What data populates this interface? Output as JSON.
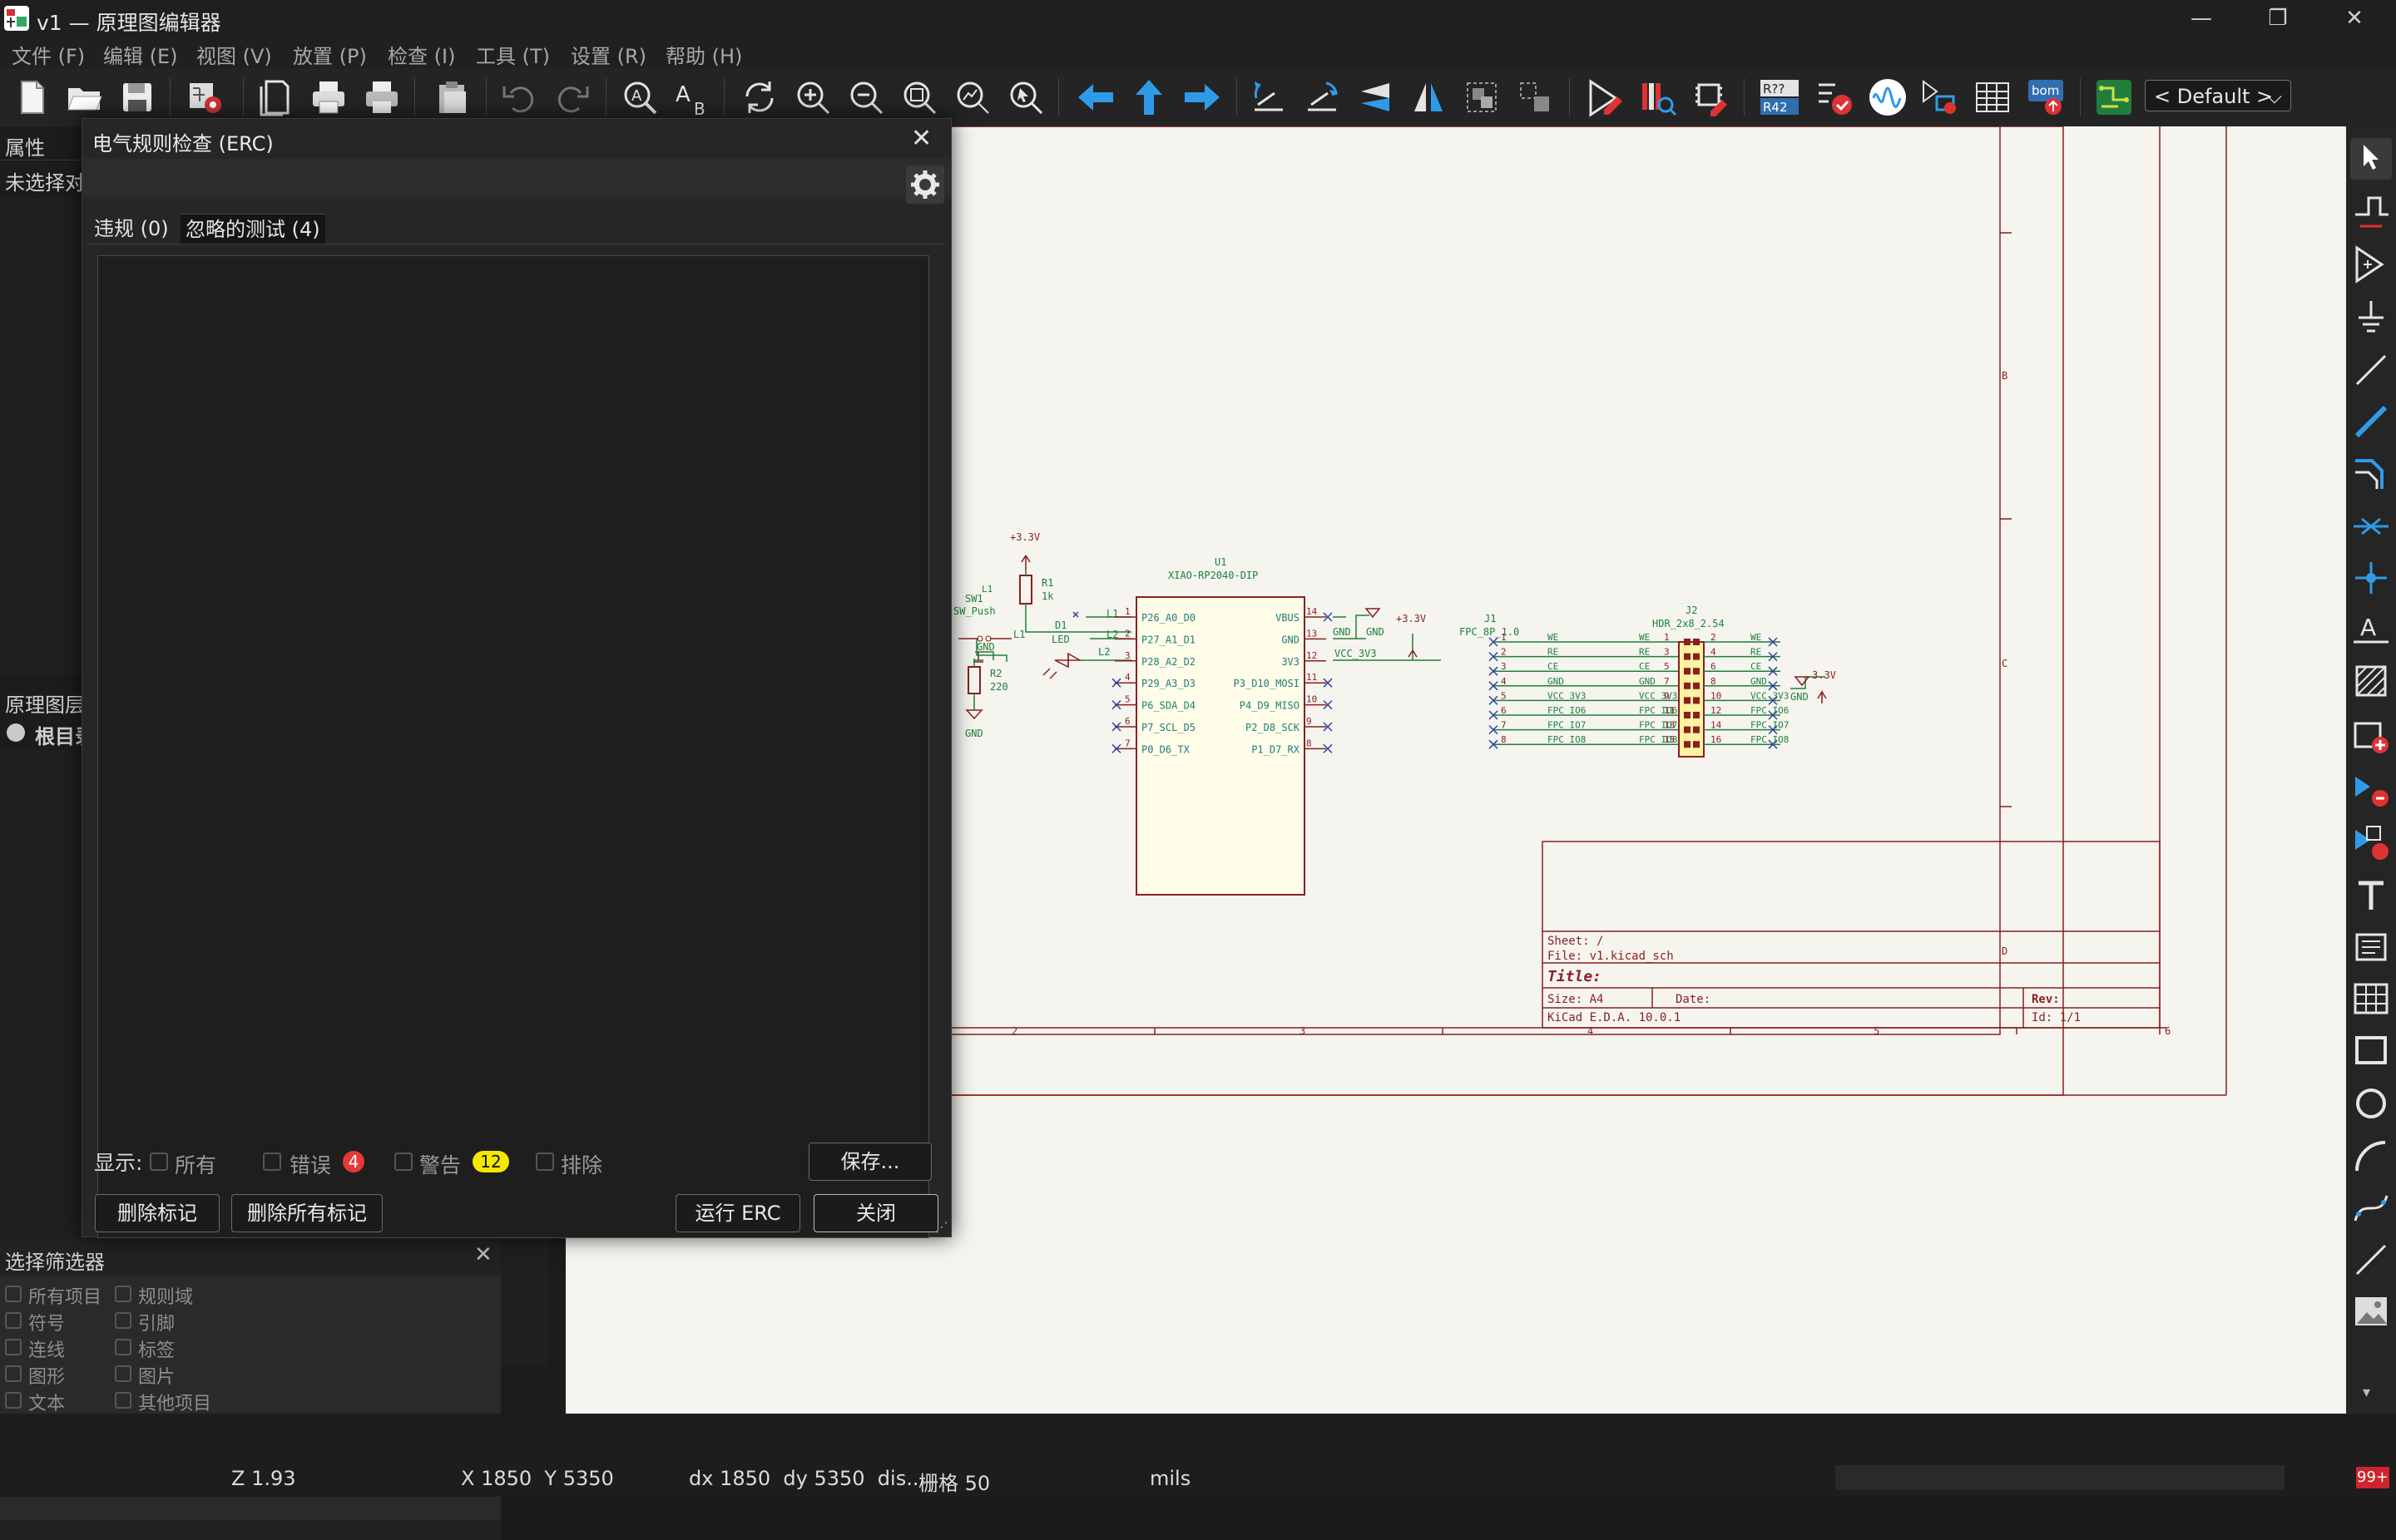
{
  "window": {
    "title": "v1 — 原理图编辑器",
    "minimize": "—",
    "restore": "❐",
    "close": "✕"
  },
  "menu": [
    "文件 (F)",
    "编辑 (E)",
    "视图 (V)",
    "放置 (P)",
    "检查 (I)",
    "工具 (T)",
    "设置 (R)",
    "帮助 (H)"
  ],
  "toolbar": {
    "zoom_preset": "< Default >",
    "ref_top": "R??",
    "ref_bottom": "R42",
    "bom": "bom"
  },
  "properties_panel": {
    "title": "属性",
    "empty_text": "未选择对"
  },
  "hierarchy_panel": {
    "title": "原理图层",
    "root": "根目录"
  },
  "selection_filter": {
    "title": "选择筛选器",
    "items": [
      "所有项目",
      "规则域",
      "符号",
      "引脚",
      "连线",
      "标签",
      "图形",
      "图片",
      "文本",
      "其他项目"
    ]
  },
  "erc_dialog": {
    "title": "电气规则检查 (ERC)",
    "tabs": [
      {
        "label": "违规 (0)"
      },
      {
        "label": "忽略的测试 (4)"
      }
    ],
    "show_label": "显示:",
    "filters": {
      "all": "所有",
      "errors": "错误",
      "errors_count": "4",
      "warnings": "警告",
      "warnings_count": "12",
      "excluded": "排除"
    },
    "save_button": "保存...",
    "delete_marker": "删除标记",
    "delete_all_markers": "删除所有标记",
    "run_erc": "运行 ERC",
    "close_button": "关闭"
  },
  "status": {
    "zoom": "Z 1.93",
    "xy": "X 1850  Y 5350",
    "dxdy": "dx 1850  dy 5350  dis...",
    "grid": "栅格 50",
    "units": "mils",
    "notifications": "99+"
  },
  "schematic": {
    "border_cols": [
      "2",
      "3",
      "4",
      "5",
      "6"
    ],
    "border_rows": [
      "B",
      "C",
      "D"
    ],
    "title_block": {
      "sheet": "Sheet: /",
      "file": "File: v1.kicad_sch",
      "title": "Title:",
      "size": "Size: A4",
      "date": "Date:",
      "rev": "Rev:",
      "kicad": "KiCad E.D.A. 10.0.1",
      "id": "Id: 1/1"
    },
    "u1": {
      "ref": "U1",
      "value": "XIAO-RP2040-DIP",
      "left_pins": [
        {
          "num": "1",
          "name": "P26_A0_D0"
        },
        {
          "num": "2",
          "name": "P27_A1_D1"
        },
        {
          "num": "3",
          "name": "P28_A2_D2"
        },
        {
          "num": "4",
          "name": "P29_A3_D3"
        },
        {
          "num": "5",
          "name": "P6_SDA_D4"
        },
        {
          "num": "6",
          "name": "P7_SCL_D5"
        },
        {
          "num": "7",
          "name": "P0_D6_TX"
        }
      ],
      "right_pins": [
        {
          "num": "14",
          "name": "VBUS"
        },
        {
          "num": "13",
          "name": "GND"
        },
        {
          "num": "12",
          "name": "3V3"
        },
        {
          "num": "11",
          "name": "P3_D10_MOSI"
        },
        {
          "num": "10",
          "name": "P4_D9_MISO"
        },
        {
          "num": "9",
          "name": "P2_D8_SCK"
        },
        {
          "num": "8",
          "name": "P1_D7_RX"
        }
      ]
    },
    "labels": {
      "gnd": "GND",
      "v33": "+3.3V",
      "vcc": "VCC_3V3",
      "l1": "L1",
      "l2": "L2",
      "r1": "R1",
      "r1v": "1k",
      "r2": "R2",
      "r2v": "220",
      "d1": "D1",
      "d1v": "LED",
      "sw": "SW1",
      "swv": "SW_Push",
      "j1": "J1",
      "j1v": "FPC_8P_1.0",
      "j2": "J2",
      "j2v": "HDR_2x8_2.54",
      "v33b": "3.3V"
    },
    "j1_pins": [
      {
        "num": "1",
        "net": "WE"
      },
      {
        "num": "2",
        "net": "RE"
      },
      {
        "num": "3",
        "net": "CE"
      },
      {
        "num": "4",
        "net": "GND"
      },
      {
        "num": "5",
        "net": "VCC_3V3"
      },
      {
        "num": "6",
        "net": "FPC_IO6"
      },
      {
        "num": "7",
        "net": "FPC_IO7"
      },
      {
        "num": "8",
        "net": "FPC_IO8"
      }
    ],
    "j2_left": [
      {
        "num": "1",
        "net": "WE"
      },
      {
        "num": "3",
        "net": "RE"
      },
      {
        "num": "5",
        "net": "CE"
      },
      {
        "num": "7",
        "net": "GND"
      },
      {
        "num": "9",
        "net": "VCC_3V3"
      },
      {
        "num": "11",
        "net": "FPC_IO6"
      },
      {
        "num": "13",
        "net": "FPC_IO7"
      },
      {
        "num": "15",
        "net": "FPC_IO8"
      }
    ],
    "j2_right": [
      {
        "num": "2",
        "net": "WE"
      },
      {
        "num": "4",
        "net": "RE"
      },
      {
        "num": "6",
        "net": "CE"
      },
      {
        "num": "8",
        "net": "GND"
      },
      {
        "num": "10",
        "net": "VCC_3V3"
      },
      {
        "num": "12",
        "net": "FPC_IO6"
      },
      {
        "num": "14",
        "net": "FPC_IO7"
      },
      {
        "num": "16",
        "net": "FPC_IO8"
      }
    ]
  }
}
